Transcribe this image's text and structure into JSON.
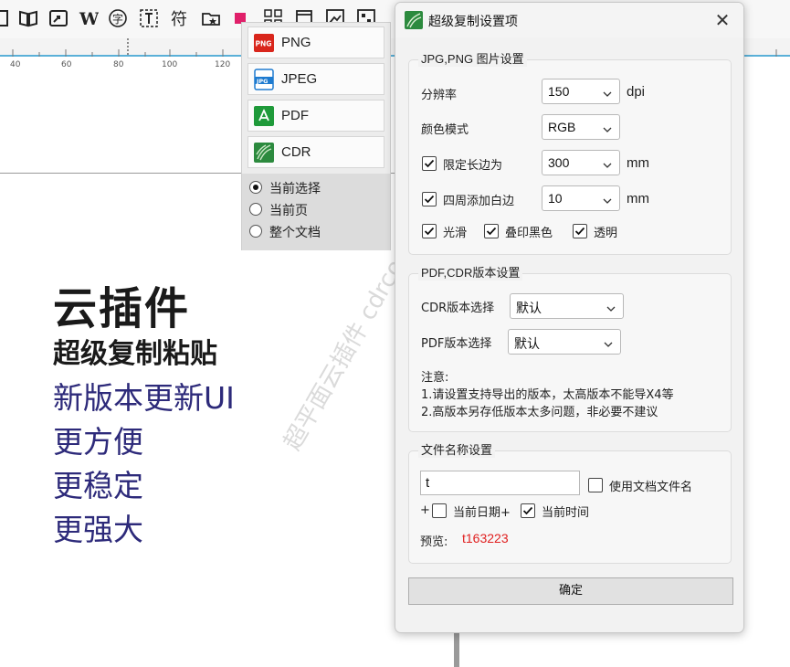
{
  "ruler": {
    "ticks": [
      "40",
      "60",
      "80",
      "100",
      "120"
    ]
  },
  "format_menu": {
    "items": [
      {
        "label": "PNG",
        "icon": "png-file-icon"
      },
      {
        "label": "JPEG",
        "icon": "jpeg-file-icon"
      },
      {
        "label": "PDF",
        "icon": "pdf-file-icon"
      },
      {
        "label": "CDR",
        "icon": "cdr-file-icon"
      }
    ],
    "scope_options": [
      {
        "label": "当前选择",
        "selected": true
      },
      {
        "label": "当前页",
        "selected": false
      },
      {
        "label": "整个文档",
        "selected": false
      }
    ]
  },
  "promo": {
    "title": "云插件",
    "subtitle": "超级复制粘贴",
    "lines": [
      "新版本更新UI",
      "更方便",
      "更稳定",
      "更强大"
    ],
    "watermark": "超平面云插件 cdrcoo.cn"
  },
  "dialog": {
    "title": "超级复制设置项",
    "image_group": {
      "title": "JPG,PNG 图片设置",
      "resolution_label": "分辨率",
      "resolution_value": "150",
      "resolution_unit": "dpi",
      "color_mode_label": "颜色模式",
      "color_mode_value": "RGB",
      "limit_long_edge_label": "限定长边为",
      "limit_long_edge_checked": true,
      "limit_long_edge_value": "300",
      "limit_long_edge_unit": "mm",
      "add_margin_label": "四周添加白边",
      "add_margin_checked": true,
      "add_margin_value": "10",
      "add_margin_unit": "mm",
      "smooth_label": "光滑",
      "smooth_checked": true,
      "overprint_label": "叠印黑色",
      "overprint_checked": true,
      "transparent_label": "透明",
      "transparent_checked": true
    },
    "version_group": {
      "title": "PDF,CDR版本设置",
      "cdr_label": "CDR版本选择",
      "cdr_value": "默认",
      "pdf_label": "PDF版本选择",
      "pdf_value": "默认",
      "note_title": "注意:",
      "note_1": "1.请设置支持导出的版本，太高版本不能导X4等",
      "note_2": "2.高版本另存低版本太多问题，非必要不建议"
    },
    "filename_group": {
      "title": "文件名称设置",
      "name_value": "t",
      "use_doc_name_label": "使用文档文件名",
      "use_doc_name_checked": false,
      "plus_1": "+",
      "date_label": "当前日期+",
      "date_checked": false,
      "time_label": "当前时间",
      "time_checked": true,
      "preview_label": "预览:",
      "preview_value": "t163223",
      "preview_color": "#e02020"
    },
    "ok_label": "确定"
  },
  "colors": {
    "accent_ruler": "#5ab0d8",
    "promo_blue": "#2d2a7a"
  }
}
